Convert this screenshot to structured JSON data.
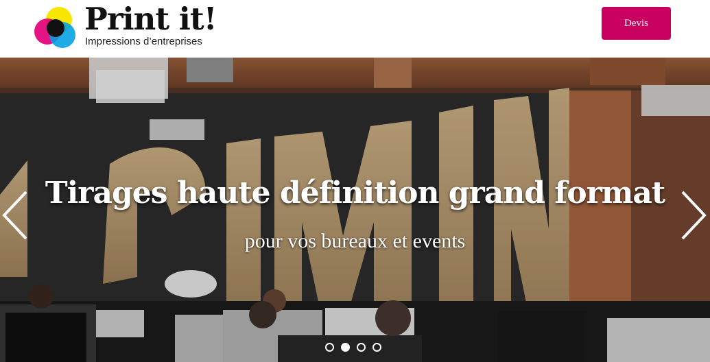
{
  "brand": {
    "title": "Print it!",
    "subtitle": "Impressions d’entreprises",
    "logo_colors": [
      "#f7e600",
      "#e2007a",
      "#009fe3",
      "#111111"
    ]
  },
  "nav": {
    "devis_label": "Devis",
    "button_color": "#c8005f"
  },
  "hero": {
    "title": "Tirages haute définition grand format",
    "subtitle": "pour vos bureaux et events",
    "prev_icon": "chevron-left-icon",
    "next_icon": "chevron-right-icon",
    "slide_count": 4,
    "active_slide": 2
  }
}
